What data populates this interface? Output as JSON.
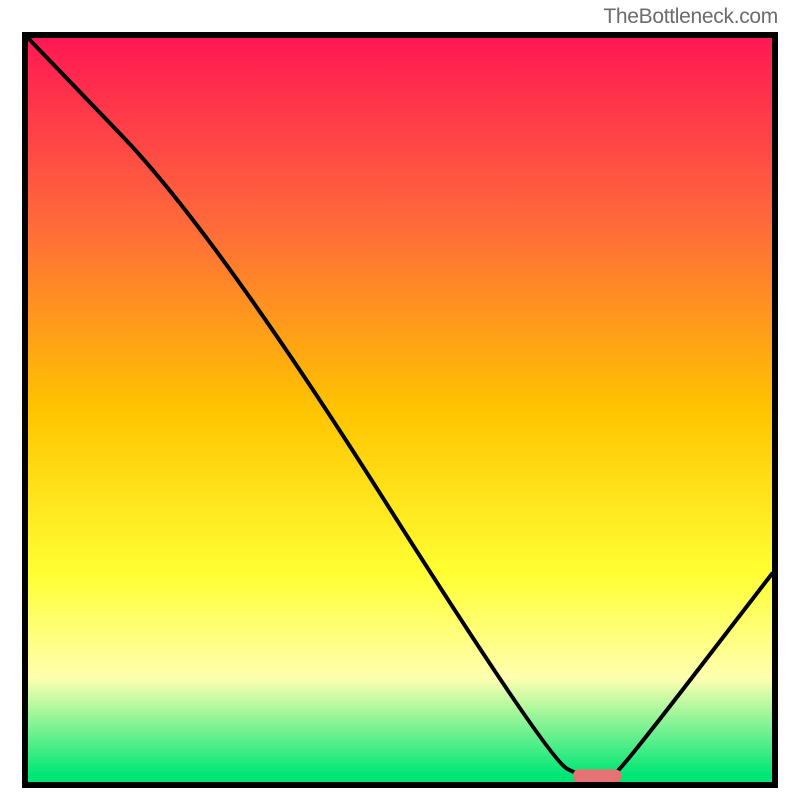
{
  "watermark": "TheBottleneck.com",
  "colors": {
    "border": "#000000",
    "watermark_text": "#6c6c6c",
    "gradient_top": "#ff1854",
    "gradient_mid1": "#ff7a30",
    "gradient_mid2": "#ffd000",
    "gradient_yellow": "#ffff33",
    "gradient_pale": "#ffffb0",
    "gradient_bottom": "#00e676",
    "marker_fill": "#e57373",
    "curve": "#000000"
  },
  "chart_data": {
    "type": "line",
    "title": "",
    "xlabel": "",
    "ylabel": "",
    "xlim": [
      0,
      100
    ],
    "ylim": [
      0,
      100
    ],
    "grid": false,
    "series": [
      {
        "name": "bottleneck-curve",
        "x": [
          0,
          25,
          70,
          75,
          78,
          80,
          100
        ],
        "values": [
          100,
          74,
          3,
          0.5,
          0.5,
          2,
          28
        ]
      }
    ],
    "marker": {
      "x_center": 76.5,
      "y": 0.8,
      "width": 6.5,
      "height": 1.8
    },
    "background_gradient_stops": [
      {
        "pct": 0,
        "color": "#ff1854"
      },
      {
        "pct": 25,
        "color": "#ff6a3a"
      },
      {
        "pct": 50,
        "color": "#ffc400"
      },
      {
        "pct": 72,
        "color": "#ffff33"
      },
      {
        "pct": 86,
        "color": "#ffffb0"
      },
      {
        "pct": 99,
        "color": "#00e676"
      }
    ]
  }
}
